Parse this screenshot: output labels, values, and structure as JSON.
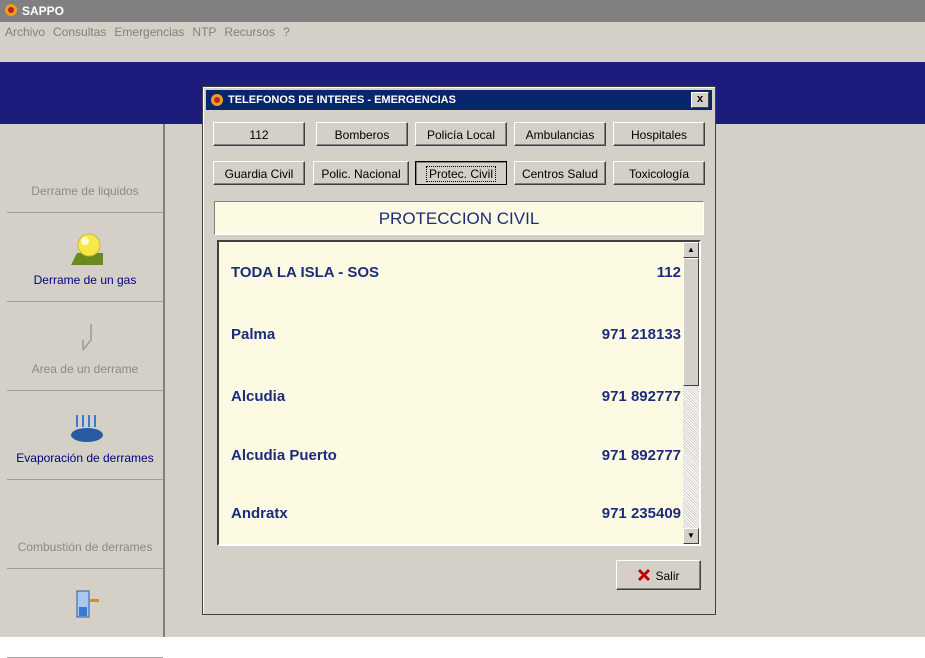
{
  "app": {
    "title": "SAPPO"
  },
  "menu": [
    "Archivo",
    "Consultas",
    "Emergencias",
    "NTP",
    "Recursos",
    "?"
  ],
  "sidebar": {
    "items": [
      {
        "label": "Derrame de liquidos",
        "enabled": false,
        "icon": "none"
      },
      {
        "label": "Derrame de un gas",
        "enabled": true,
        "icon": "gas-cloud-icon"
      },
      {
        "label": "Area de un derrame",
        "enabled": false,
        "icon": "spill-area-icon"
      },
      {
        "label": "Evaporación de derrames",
        "enabled": true,
        "icon": "evaporation-icon"
      },
      {
        "label": "Combustión de derrames",
        "enabled": false,
        "icon": "none"
      },
      {
        "label": "",
        "enabled": true,
        "icon": "tank-leak-icon"
      }
    ]
  },
  "dialog": {
    "title": "TELEFONOS DE INTERES - EMERGENCIAS",
    "close_label": "x",
    "buttons_row1": [
      "112",
      "Bomberos",
      "Policía Local",
      "Ambulancias",
      "Hospitales"
    ],
    "buttons_row2": [
      "Guardia Civil",
      "Polic. Nacional",
      "Protec. Civil",
      "Centros Salud",
      "Toxicología"
    ],
    "selected": "Protec. Civil",
    "section_title": "PROTECCION CIVIL",
    "entries": [
      {
        "name": "TODA LA ISLA - SOS",
        "phone": "112"
      },
      {
        "name": "Palma",
        "phone": "971 218133"
      },
      {
        "name": "Alcudia",
        "phone": "971 892777"
      },
      {
        "name": "Alcudia Puerto",
        "phone": "971 892777"
      },
      {
        "name": "Andratx",
        "phone": "971 235409"
      }
    ],
    "exit_label": "Salir"
  },
  "colors": {
    "banner": "#1c1c7c",
    "title_active": "#08246b",
    "list_bg": "#fdfae4",
    "list_text": "#1c2c7c"
  }
}
